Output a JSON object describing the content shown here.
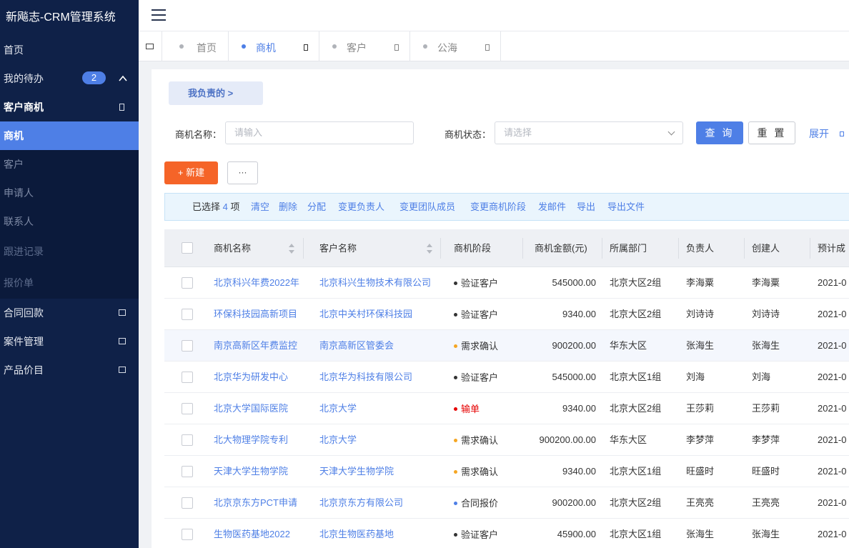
{
  "app": {
    "title": "新飚志-CRM管理系统"
  },
  "sidebar": {
    "home": "首页",
    "todo": {
      "label": "我的待办",
      "badge": "2"
    },
    "group_customer_opportunity": "客户商机",
    "sub_items": [
      "商机",
      "客户",
      "申请人",
      "联系人",
      "跟进记录",
      "报价单"
    ],
    "active_sub": "商机",
    "bottom_items": [
      "合同回款",
      "案件管理",
      "产品价目"
    ]
  },
  "tabs": [
    {
      "label": "首页",
      "active": false
    },
    {
      "label": "商机",
      "active": true
    },
    {
      "label": "客户",
      "active": false
    },
    {
      "label": "公海",
      "active": false
    }
  ],
  "filters": {
    "mine_button": "我负责的  >",
    "name_label": "商机名称：",
    "name_placeholder": "请输入",
    "status_label": "商机状态：",
    "status_placeholder": "请选择",
    "query": "查 询",
    "reset": "重 置",
    "expand": "展开"
  },
  "toolbar": {
    "new": "+ 新建",
    "more": "···"
  },
  "selection": {
    "prefix": "已选择",
    "count": "4",
    "suffix": "项",
    "actions": [
      "清空",
      "删除",
      "分配",
      "变更负责人",
      "变更团队成员",
      "变更商机阶段",
      "发邮件",
      "导出",
      "导出文件"
    ]
  },
  "table": {
    "columns": [
      "商机名称",
      "客户名称",
      "商机阶段",
      "商机金额(元)",
      "所属部门",
      "负责人",
      "创建人",
      "预计成交"
    ],
    "rows": [
      {
        "name": "北京科兴年费2022年",
        "customer": "北京科兴生物技术有限公司",
        "stage": "验证客户",
        "stage_color": "#333333",
        "amount": "545000.00",
        "dept": "北京大区2组",
        "owner": "李海粟",
        "creator": "李海粟",
        "date": "2021-0"
      },
      {
        "name": "环保科技园高新项目",
        "customer": "北京中关村环保科技园",
        "stage": "验证客户",
        "stage_color": "#333333",
        "amount": "9340.00",
        "dept": "北京大区2组",
        "owner": "刘诗诗",
        "creator": "刘诗诗",
        "date": "2021-0"
      },
      {
        "name": "南京高新区年费监控",
        "customer": "南京高新区管委会",
        "stage": "需求确认",
        "stage_color": "#f5a623",
        "amount": "900200.00",
        "dept": "华东大区",
        "owner": "张海生",
        "creator": "张海生",
        "date": "2021-0"
      },
      {
        "name": "北京华为研发中心",
        "customer": "北京华为科技有限公司",
        "stage": "验证客户",
        "stage_color": "#333333",
        "amount": "545000.00",
        "dept": "北京大区1组",
        "owner": "刘海",
        "creator": "刘海",
        "date": "2021-0"
      },
      {
        "name": "北京大学国际医院",
        "customer": "北京大学",
        "stage": "输单",
        "stage_color": "#e60000",
        "amount": "9340.00",
        "dept": "北京大区2组",
        "owner": "王莎莉",
        "creator": "王莎莉",
        "date": "2021-0"
      },
      {
        "name": "北大物理学院专利",
        "customer": "北京大学",
        "stage": "需求确认",
        "stage_color": "#f5a623",
        "amount": "900200.00.00",
        "dept": "华东大区",
        "owner": "李梦萍",
        "creator": "李梦萍",
        "date": "2021-0"
      },
      {
        "name": "天津大学生物学院",
        "customer": "天津大学生物学院",
        "stage": "需求确认",
        "stage_color": "#f5a623",
        "amount": "9340.00",
        "dept": "北京大区1组",
        "owner": "旺盛时",
        "creator": "旺盛时",
        "date": "2021-0"
      },
      {
        "name": "北京京东方PCT申请",
        "customer": "北京京东方有限公司",
        "stage": "合同报价",
        "stage_color": "#4e7fe6",
        "amount": "900200.00",
        "dept": "北京大区2组",
        "owner": "王亮亮",
        "creator": "王亮亮",
        "date": "2021-0"
      },
      {
        "name": "生物医药基地2022",
        "customer": "北京生物医药基地",
        "stage": "验证客户",
        "stage_color": "#333333",
        "amount": "45900.00",
        "dept": "北京大区1组",
        "owner": "张海生",
        "creator": "张海生",
        "date": "2021-0"
      }
    ]
  }
}
